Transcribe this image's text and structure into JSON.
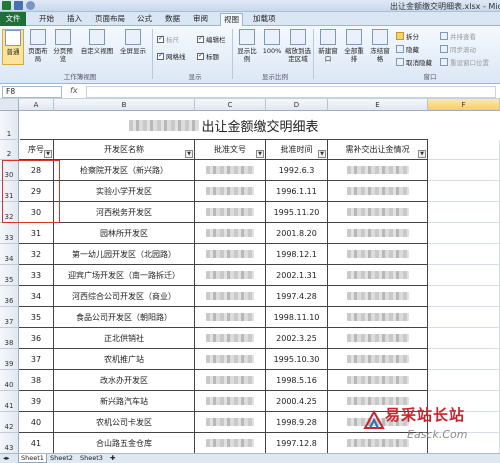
{
  "window": {
    "title": "出让金额缴交明细表.xlsx - Micro"
  },
  "ribbon_tabs": [
    "文件",
    "开始",
    "插入",
    "页面布局",
    "公式",
    "数据",
    "审阅",
    "视图",
    "加载项"
  ],
  "ribbon": {
    "view_buttons": [
      "普通",
      "页面布局",
      "分页预览",
      "自定义视图",
      "全屏显示"
    ],
    "checkboxes": [
      {
        "label": "标尺",
        "checked": true,
        "dim": true
      },
      {
        "label": "编辑栏",
        "checked": true,
        "dim": false
      },
      {
        "label": "网格线",
        "checked": true,
        "dim": false
      },
      {
        "label": "标题",
        "checked": true,
        "dim": false
      }
    ],
    "zoom_buttons": [
      "显示比例",
      "100%",
      "缩放到选定区域"
    ],
    "window_buttons": [
      "新建窗口",
      "全部重排",
      "冻结窗格"
    ],
    "window_small": [
      "拆分",
      "隐藏",
      "取消隐藏"
    ],
    "right_small": [
      "并排查看",
      "同步滚动",
      "重设窗口位置"
    ],
    "groups": [
      "工作簿视图",
      "显示",
      "显示比例",
      "窗口"
    ]
  },
  "formula_bar": {
    "name_box": "F8",
    "fx": "fx",
    "value": ""
  },
  "columns": [
    "A",
    "B",
    "C",
    "D",
    "E",
    "F"
  ],
  "sheet": {
    "title_blurred_prefix": "",
    "title": "出让金额缴交明细表",
    "headers": [
      "序号",
      "开发区名称",
      "批准文号",
      "批准时间",
      "需补交出让金情况"
    ],
    "rows": [
      {
        "row": "30",
        "no": "28",
        "name": "检察院开发区（新兴路）",
        "date": "1992.6.3"
      },
      {
        "row": "31",
        "no": "29",
        "name": "实验小学开发区",
        "date": "1996.1.11"
      },
      {
        "row": "32",
        "no": "30",
        "name": "河西税务开发区",
        "date": "1995.11.20"
      },
      {
        "row": "33",
        "no": "31",
        "name": "园林所开发区",
        "date": "2001.8.20"
      },
      {
        "row": "34",
        "no": "32",
        "name": "第一幼儿园开发区（北园路）",
        "date": "1998.12.1"
      },
      {
        "row": "35",
        "no": "33",
        "name": "迎宾广场开发区（南一路拆迁）",
        "date": "2002.1.31"
      },
      {
        "row": "36",
        "no": "34",
        "name": "河西综合公司开发区（商业）",
        "date": "1997.4.28"
      },
      {
        "row": "37",
        "no": "35",
        "name": "食品公司开发区（朝阳路）",
        "date": "1998.11.10"
      },
      {
        "row": "38",
        "no": "36",
        "name": "正北供销社",
        "date": "2002.3.25"
      },
      {
        "row": "39",
        "no": "37",
        "name": "农机推广站",
        "date": "1995.10.30"
      },
      {
        "row": "40",
        "no": "38",
        "name": "改水办开发区",
        "date": "1998.5.16"
      },
      {
        "row": "41",
        "no": "39",
        "name": "新兴路汽车站",
        "date": "2000.4.25"
      },
      {
        "row": "42",
        "no": "40",
        "name": "农机公司卡发区",
        "date": "1998.9.28"
      },
      {
        "row": "43",
        "no": "41",
        "name": "合山路五金仓库",
        "date": "1997.12.8"
      }
    ],
    "row_labels": [
      "1",
      "2"
    ]
  },
  "sheet_tabs": [
    "Sheet1",
    "Sheet2",
    "Sheet3"
  ],
  "watermark": {
    "text": "易采站长站",
    "url": "Easck.Com"
  }
}
